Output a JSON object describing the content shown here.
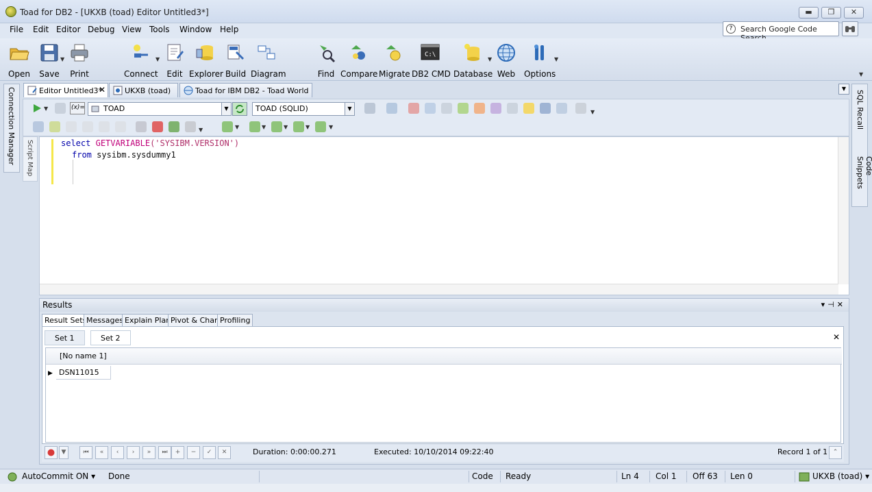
{
  "window": {
    "title": "Toad for DB2 - [UKXB (toad) Editor Untitled3*]",
    "minimize": "▬",
    "maximize": "❐",
    "close": "✕"
  },
  "menu": [
    "File",
    "Edit",
    "Editor",
    "Debug",
    "View",
    "Tools",
    "Window",
    "Help"
  ],
  "code_search": {
    "label": "Search Google Code Search",
    "help": "?"
  },
  "toolbar": [
    {
      "label": "Open",
      "icon": "open-folder-icon"
    },
    {
      "label": "Save",
      "icon": "save-icon"
    },
    {
      "label": "Print",
      "icon": "print-icon"
    },
    {
      "label": "Connect",
      "icon": "connect-icon"
    },
    {
      "label": "Edit",
      "icon": "sql-edit-icon"
    },
    {
      "label": "Explorer",
      "icon": "explorer-icon"
    },
    {
      "label": "Build",
      "icon": "build-icon"
    },
    {
      "label": "Diagram",
      "icon": "diagram-icon"
    },
    {
      "label": "Find",
      "icon": "find-icon"
    },
    {
      "label": "Compare",
      "icon": "compare-icon"
    },
    {
      "label": "Migrate",
      "icon": "migrate-icon"
    },
    {
      "label": "DB2 CMD",
      "icon": "db2-cmd-icon"
    },
    {
      "label": "Database",
      "icon": "database-icon"
    },
    {
      "label": "Web",
      "icon": "web-globe-icon"
    },
    {
      "label": "Options",
      "icon": "options-icon"
    }
  ],
  "left_dock": {
    "connection_manager": "Connection Manager",
    "script_map": "Script Map"
  },
  "right_dock": {
    "sql_recall": "SQL Recall",
    "code_snippets": "Code Snippets"
  },
  "doc_tabs": [
    {
      "label": "Editor Untitled3*",
      "active": true
    },
    {
      "label": "UKXB (toad)",
      "active": false
    },
    {
      "label": "Toad for IBM DB2 - Toad World",
      "active": false
    }
  ],
  "editor_toolbar": {
    "schema": "TOAD",
    "sqlid": "TOAD (SQLID)",
    "var_label": "(x)="
  },
  "editor": {
    "line1": {
      "kw": "select",
      "fn": "GETVARIABLE",
      "args": "('SYSIBM.VERSION')"
    },
    "line2": {
      "kw": "from",
      "table": "sysibm.sysdummy1"
    }
  },
  "results": {
    "title": "Results",
    "tabs": [
      "Result Sets",
      "Messages",
      "Explain Plan",
      "Pivot & Chart",
      "Profiling"
    ],
    "sets": [
      "Set 1",
      "Set 2"
    ],
    "column_header": "[No name 1]",
    "rows": [
      "DSN11015"
    ],
    "duration": "Duration: 0:00:00.271",
    "executed": "Executed: 10/10/2014 09:22:40",
    "record": "Record 1 of 1"
  },
  "status": {
    "autocommit": "AutoCommit ON",
    "state": "Done",
    "mode": "Code",
    "ready": "Ready",
    "ln": "Ln 4",
    "col": "Col 1",
    "off": "Off 63",
    "len": "Len 0",
    "connection": "UKXB (toad)"
  }
}
